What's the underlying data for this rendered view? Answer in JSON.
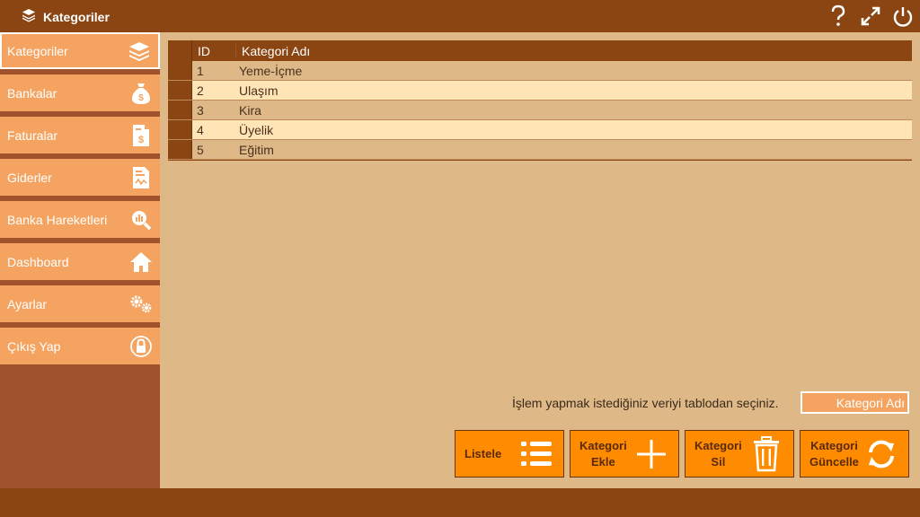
{
  "window": {
    "title": "Kategoriler",
    "controls": [
      "help-icon",
      "maximize-icon",
      "power-icon"
    ]
  },
  "sidebar": {
    "items": [
      {
        "label": "Kategoriler",
        "icon": "layers-icon",
        "active": true
      },
      {
        "label": "Bankalar",
        "icon": "money-bag-icon"
      },
      {
        "label": "Faturalar",
        "icon": "invoice-icon"
      },
      {
        "label": "Giderler",
        "icon": "expense-document-icon"
      },
      {
        "label": "Banka Hareketleri",
        "icon": "analytics-icon"
      },
      {
        "label": "Dashboard",
        "icon": "home-icon"
      },
      {
        "label": "Ayarlar",
        "icon": "gears-icon"
      },
      {
        "label": "Çıkış Yap",
        "icon": "lock-icon"
      }
    ]
  },
  "table": {
    "columns": [
      "ID",
      "Kategori Adı"
    ],
    "rows": [
      {
        "id": "1",
        "name": "Yeme-İçme"
      },
      {
        "id": "2",
        "name": "Ulaşım"
      },
      {
        "id": "3",
        "name": "Kira"
      },
      {
        "id": "4",
        "name": "Üyelik"
      },
      {
        "id": "5",
        "name": "Eğitim"
      }
    ]
  },
  "form": {
    "hint": "İşlem yapmak istediğiniz veriyi tablodan seçiniz.",
    "name_placeholder": "Kategori Adı"
  },
  "buttons": {
    "list": "Listele",
    "add": "Kategori\nEkle",
    "delete": "Kategori\nSil",
    "update": "Kategori\nGüncelle"
  },
  "colors": {
    "titlebar": "#8b4513",
    "sidebar_item": "#f4a460",
    "main_bg": "#deb887",
    "row_alt": "#ffe4b5",
    "button": "#ff8c00"
  }
}
